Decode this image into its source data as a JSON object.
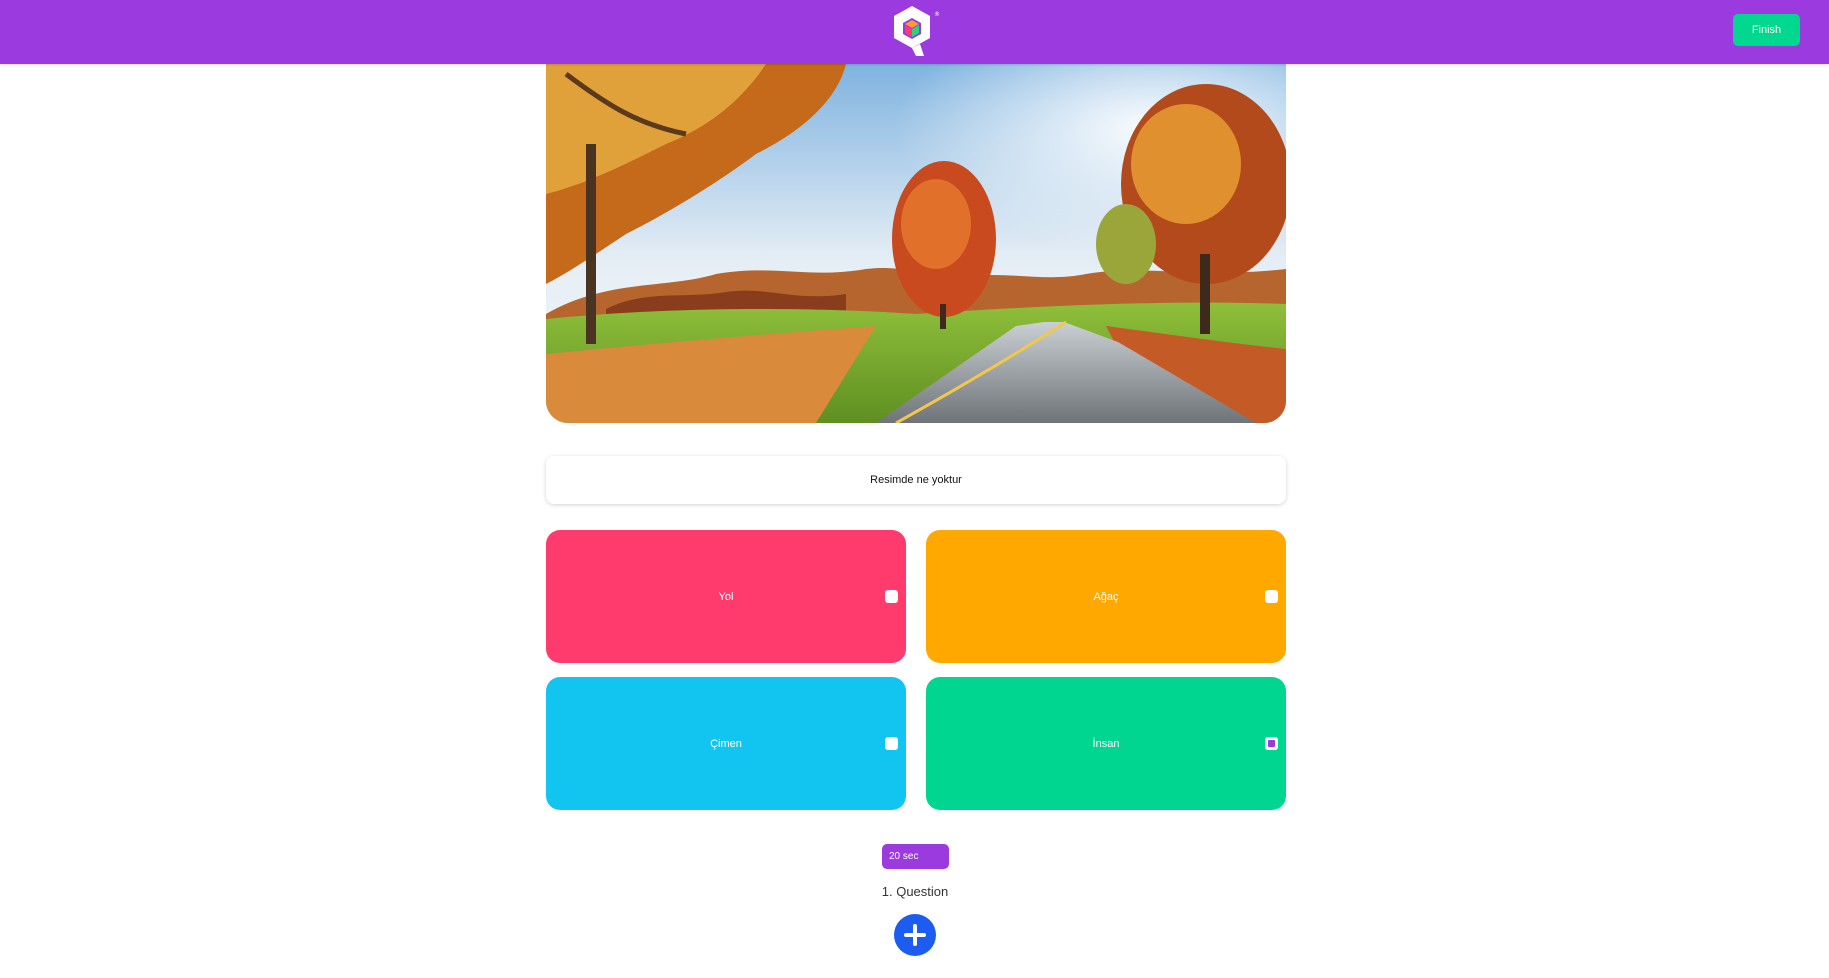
{
  "header": {
    "logo_icon": "quiz-cube-logo",
    "finish_label": "Finish",
    "bar_color": "#9b3bdf",
    "finish_color": "#00d88f"
  },
  "question": {
    "image_subject": "autumn-road-with-trees",
    "text": "Resimde ne yoktur",
    "number_label": "1. Question",
    "timer_label": "20 sec"
  },
  "answers": [
    {
      "label": "Yol",
      "color": "#ff3b6e",
      "checked": false
    },
    {
      "label": "Ağaç",
      "color": "#ffa800",
      "checked": false
    },
    {
      "label": "Çimen",
      "color": "#12c5f0",
      "checked": false
    },
    {
      "label": "İnsan",
      "color": "#00d68f",
      "checked": true
    }
  ],
  "add_button_icon": "plus-icon"
}
